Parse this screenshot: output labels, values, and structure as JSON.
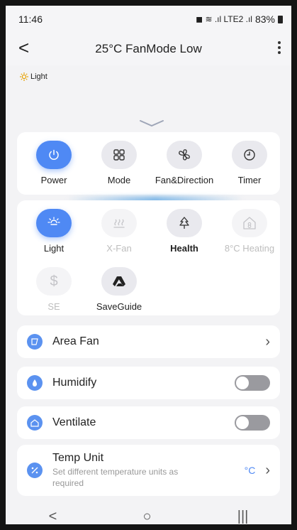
{
  "status_bar": {
    "time": "11:46",
    "icons": "◼ ≋ .ıl LTE2 .ıl",
    "battery": "83%"
  },
  "header": {
    "back_glyph": "<",
    "title": "25°C FanMode Low",
    "more_icon": "more-vertical-icon"
  },
  "status_indicator": {
    "icon": "sun-icon",
    "label": "Light"
  },
  "primary_controls": [
    {
      "label": "Power",
      "icon": "power-icon",
      "active": true
    },
    {
      "label": "Mode",
      "icon": "grid-icon",
      "active": false
    },
    {
      "label": "Fan&Direction",
      "icon": "fan-icon",
      "active": false
    },
    {
      "label": "Timer",
      "icon": "clock-icon",
      "active": false
    }
  ],
  "secondary_controls": [
    {
      "label": "Light",
      "icon": "light-icon",
      "state": "active"
    },
    {
      "label": "X-Fan",
      "icon": "heat-waves-icon",
      "state": "disabled"
    },
    {
      "label": "Health",
      "icon": "tree-icon",
      "state": "normal"
    },
    {
      "label": "8°C Heating",
      "icon": "house-8-icon",
      "state": "disabled"
    },
    {
      "label": "SE",
      "icon": "dollar-icon",
      "state": "disabled"
    },
    {
      "label": "SaveGuide",
      "icon": "save-guide-icon",
      "state": "normal"
    }
  ],
  "settings": {
    "area_fan": {
      "label": "Area Fan",
      "icon": "area-fan-icon"
    },
    "humidify": {
      "label": "Humidify",
      "icon": "droplet-icon",
      "on": false
    },
    "ventilate": {
      "label": "Ventilate",
      "icon": "house-wind-icon",
      "on": false
    },
    "temp_unit": {
      "label": "Temp Unit",
      "subtitle": "Set different temperature units as required",
      "value": "°C",
      "icon": "temp-unit-icon"
    }
  },
  "colors": {
    "accent": "#4f89f4",
    "toggle_off": "#9a9a9f",
    "card_bg": "#ffffff",
    "page_bg": "#f3f3f5"
  },
  "nav": {
    "back": "<",
    "home": "○",
    "recents": "|||"
  }
}
